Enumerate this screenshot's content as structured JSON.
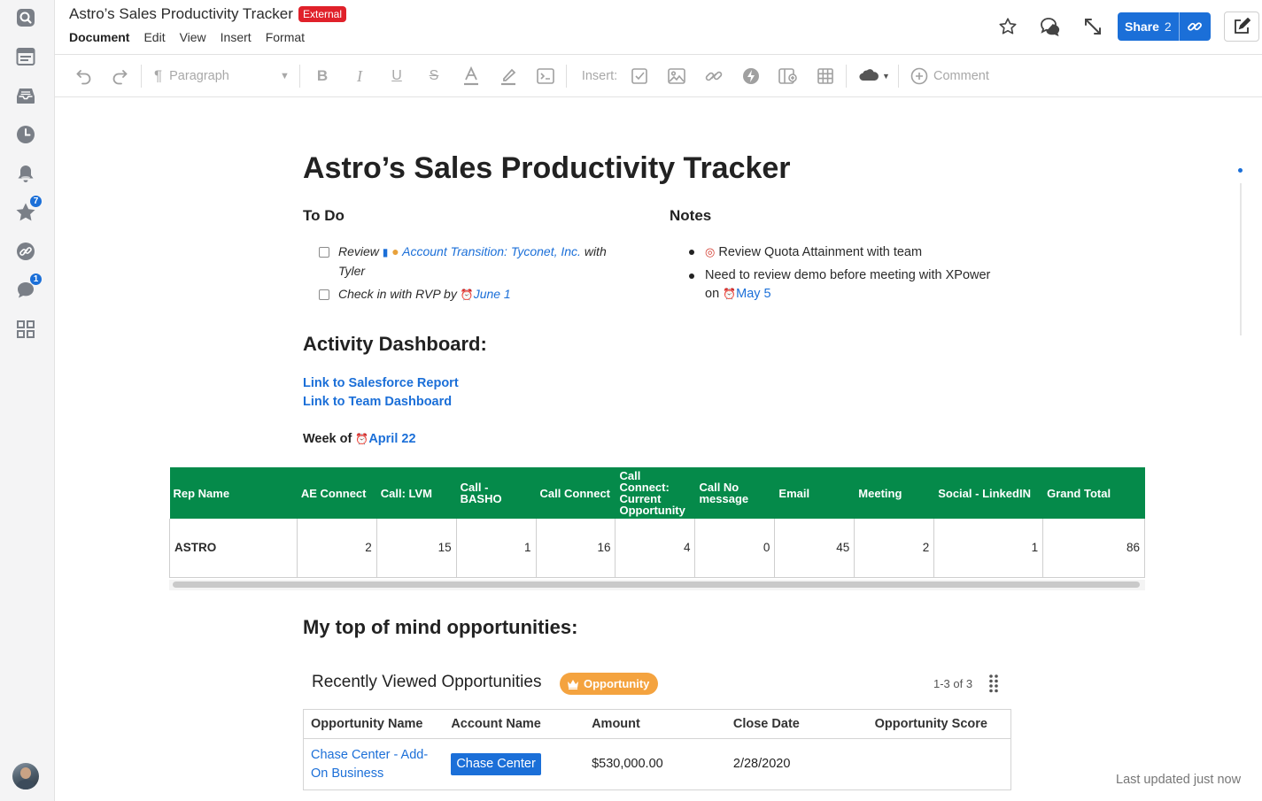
{
  "header": {
    "title": "Astro’s Sales Productivity Tracker",
    "badge": "External",
    "menu": [
      "Document",
      "Edit",
      "View",
      "Insert",
      "Format"
    ],
    "share_label": "Share",
    "share_count": "2"
  },
  "rail": {
    "items": [
      {
        "icon": "search-icon"
      },
      {
        "icon": "browser-icon"
      },
      {
        "icon": "inbox-icon"
      },
      {
        "icon": "clock-icon"
      },
      {
        "icon": "bell-icon"
      },
      {
        "icon": "star-icon",
        "badge": "7"
      },
      {
        "icon": "link-icon"
      },
      {
        "icon": "chat-icon",
        "badge": "1"
      },
      {
        "icon": "apps-grid-icon"
      }
    ]
  },
  "toolbar": {
    "paragraph_label": "Paragraph",
    "insert_label": "Insert:",
    "comment_label": "Comment"
  },
  "doc": {
    "title": "Astro’s Sales Productivity Tracker",
    "todo_heading": "To Do",
    "todo_items": [
      {
        "prefix": "Review",
        "link": "Account Transition: Tyconet, Inc.",
        "suffix": "with",
        "line2": "Tyler"
      },
      {
        "prefix": "Check in with RVP by",
        "link": "June 1"
      }
    ],
    "notes_heading": "Notes",
    "notes": [
      {
        "text": "Review Quota Attainment with team"
      },
      {
        "text": "Need to review demo before meeting with XPower",
        "line2": "on",
        "link": "May 5"
      }
    ],
    "dashboard_heading": "Activity Dashboard:",
    "links": [
      "Link to Salesforce Report",
      "Link to Team Dashboard"
    ],
    "week_label": "Week of",
    "week_date": "April 22",
    "activity_table": {
      "headers": [
        "Rep Name",
        "AE Connect",
        "Call: LVM",
        "Call - BASHO",
        "Call Connect",
        "Call Connect: Current Opportunity",
        "Call No message",
        "Email",
        "Meeting",
        "Social - LinkedIN",
        "Grand Total"
      ],
      "rows": [
        [
          "ASTRO",
          "2",
          "15",
          "1",
          "16",
          "4",
          "0",
          "45",
          "2",
          "1",
          "86"
        ]
      ]
    },
    "opps_heading": "My top of mind opportunities:",
    "opps": {
      "title": "Recently Viewed Opportunities",
      "badge": "Opportunity",
      "count": "1-3 of 3",
      "headers": [
        "Opportunity Name",
        "Account Name",
        "Amount",
        "Close Date",
        "Opportunity Score"
      ],
      "rows": [
        {
          "name_line1": "Chase Center - Add-",
          "name_line2": "On Business",
          "account": "Chase Center",
          "amount": "$530,000.00",
          "close_date": "2/28/2020",
          "score": ""
        }
      ]
    },
    "last_updated": "Last updated just now"
  },
  "colors": {
    "accent": "#1b6fd8",
    "table_header": "#058a4a",
    "external_badge": "#e0212a",
    "opportunity_badge": "#f4a33f"
  }
}
